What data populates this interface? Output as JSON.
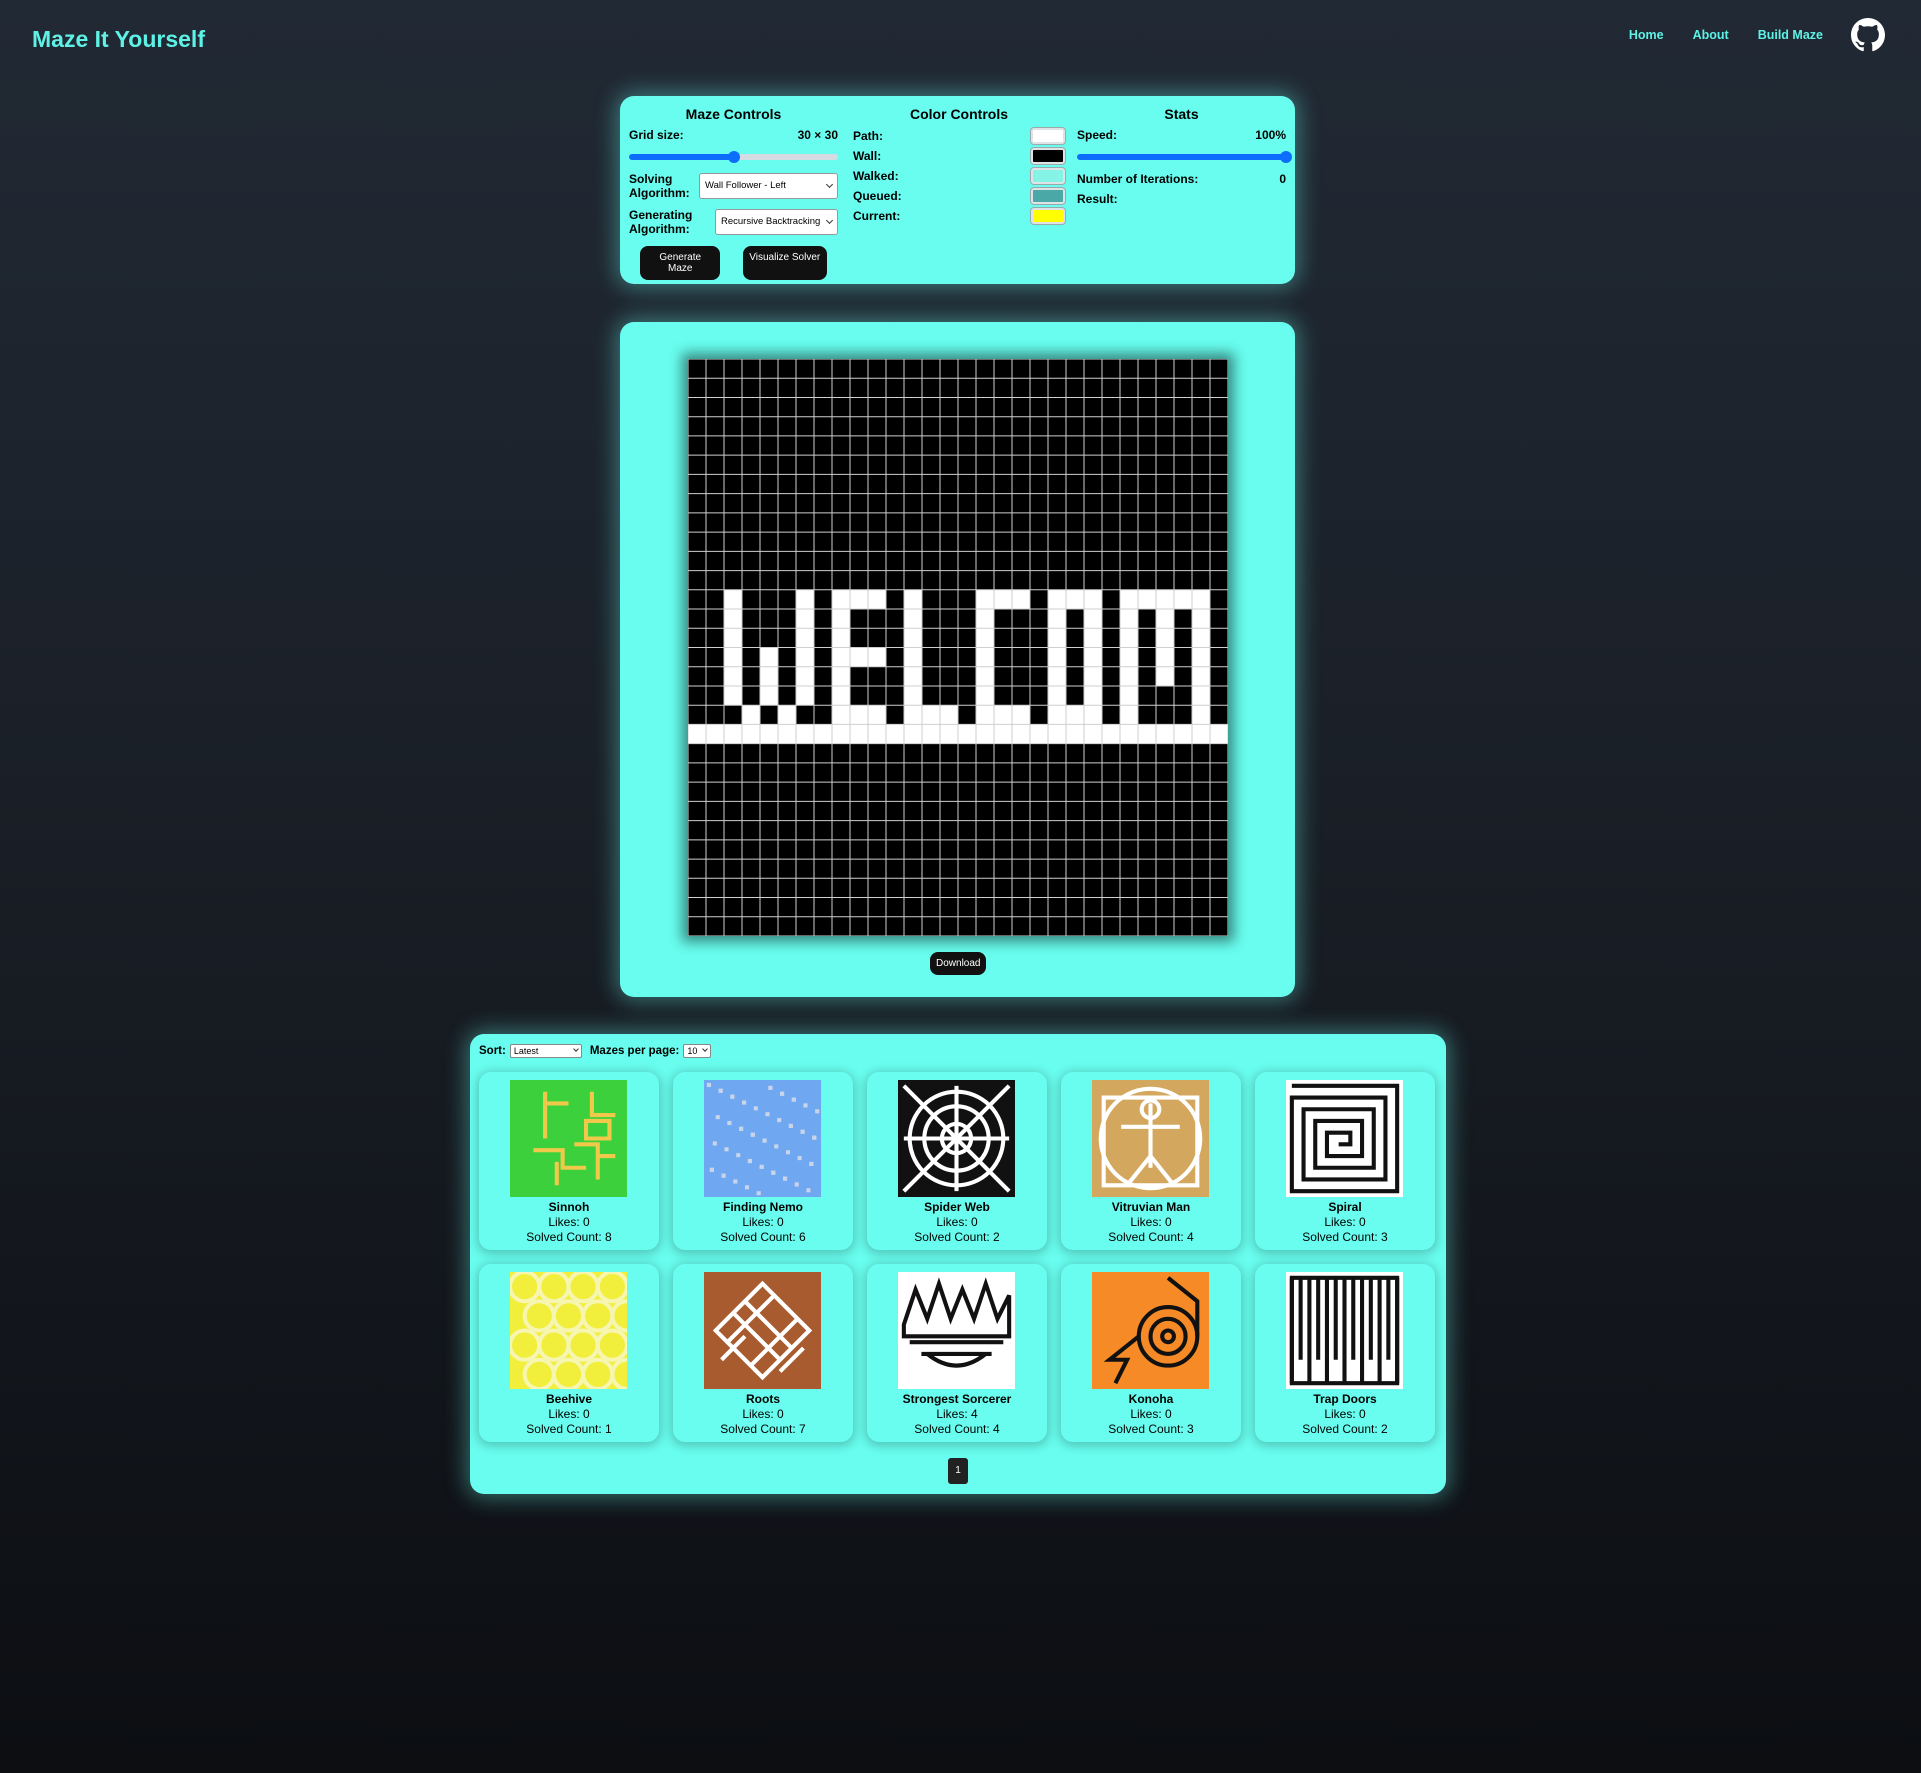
{
  "brand": "Maze It Yourself",
  "nav": {
    "home": "Home",
    "about": "About",
    "build": "Build Maze"
  },
  "controls": {
    "maze_title": "Maze Controls",
    "grid_label": "Grid size:",
    "grid_value": "30 × 30",
    "grid_slider_fraction": 0.5,
    "solving_label_1": "Solving",
    "solving_label_2": "Algorithm:",
    "solving_value": "Wall Follower - Left",
    "generating_label_1": "Generating",
    "generating_label_2": "Algorithm:",
    "generating_value": "Recursive Backtracking",
    "generate_button": "Generate Maze",
    "visualize_button": "Visualize Solver"
  },
  "colors": {
    "title": "Color Controls",
    "items": [
      {
        "label": "Path:",
        "color": "#ffffff"
      },
      {
        "label": "Wall:",
        "color": "#000000"
      },
      {
        "label": "Walked:",
        "color": "#86f3e7"
      },
      {
        "label": "Queued:",
        "color": "#4aa8a6"
      },
      {
        "label": "Current:",
        "color": "#ffff00"
      }
    ]
  },
  "stats": {
    "title": "Stats",
    "speed_label": "Speed:",
    "speed_value": "100%",
    "speed_fraction": 1.0,
    "iterations_label": "Number of Iterations:",
    "iterations_value": "0",
    "result_label": "Result:"
  },
  "maze": {
    "download_button": "Download",
    "welcome_text": "WELCOME",
    "grid_cells": 30
  },
  "gallery": {
    "sort_label": "Sort:",
    "sort_value": "Latest",
    "per_page_label": "Mazes per page:",
    "per_page_value": "10",
    "likes_prefix": "Likes: ",
    "solved_prefix": "Solved Count: ",
    "items": [
      {
        "name": "Sinnoh",
        "likes": "0",
        "solved": "8",
        "bg": "#3cd13c",
        "fg": "#f0c94a",
        "pattern": "sinnoh"
      },
      {
        "name": "Finding Nemo",
        "likes": "0",
        "solved": "6",
        "bg": "#6fa8f0",
        "fg": "#c9d4ea",
        "pattern": "nemo"
      },
      {
        "name": "Spider Web",
        "likes": "0",
        "solved": "2",
        "bg": "#111111",
        "fg": "#ffffff",
        "pattern": "web"
      },
      {
        "name": "Vitruvian Man",
        "likes": "0",
        "solved": "4",
        "bg": "#d3a85e",
        "fg": "#ffffff",
        "pattern": "vitruvian"
      },
      {
        "name": "Spiral",
        "likes": "0",
        "solved": "3",
        "bg": "#ffffff",
        "fg": "#111111",
        "pattern": "spiral"
      },
      {
        "name": "Beehive",
        "likes": "0",
        "solved": "1",
        "bg": "#f2ee3c",
        "fg": "#f6f6b0",
        "pattern": "hive"
      },
      {
        "name": "Roots",
        "likes": "0",
        "solved": "7",
        "bg": "#a75b2f",
        "fg": "#ffffff",
        "pattern": "roots"
      },
      {
        "name": "Strongest Sorcerer",
        "likes": "4",
        "solved": "4",
        "bg": "#ffffff",
        "fg": "#111111",
        "pattern": "sorcerer"
      },
      {
        "name": "Konoha",
        "likes": "0",
        "solved": "3",
        "bg": "#f58a26",
        "fg": "#111111",
        "pattern": "konoha"
      },
      {
        "name": "Trap Doors",
        "likes": "0",
        "solved": "2",
        "bg": "#ffffff",
        "fg": "#111111",
        "pattern": "trap"
      }
    ],
    "page": "1"
  }
}
